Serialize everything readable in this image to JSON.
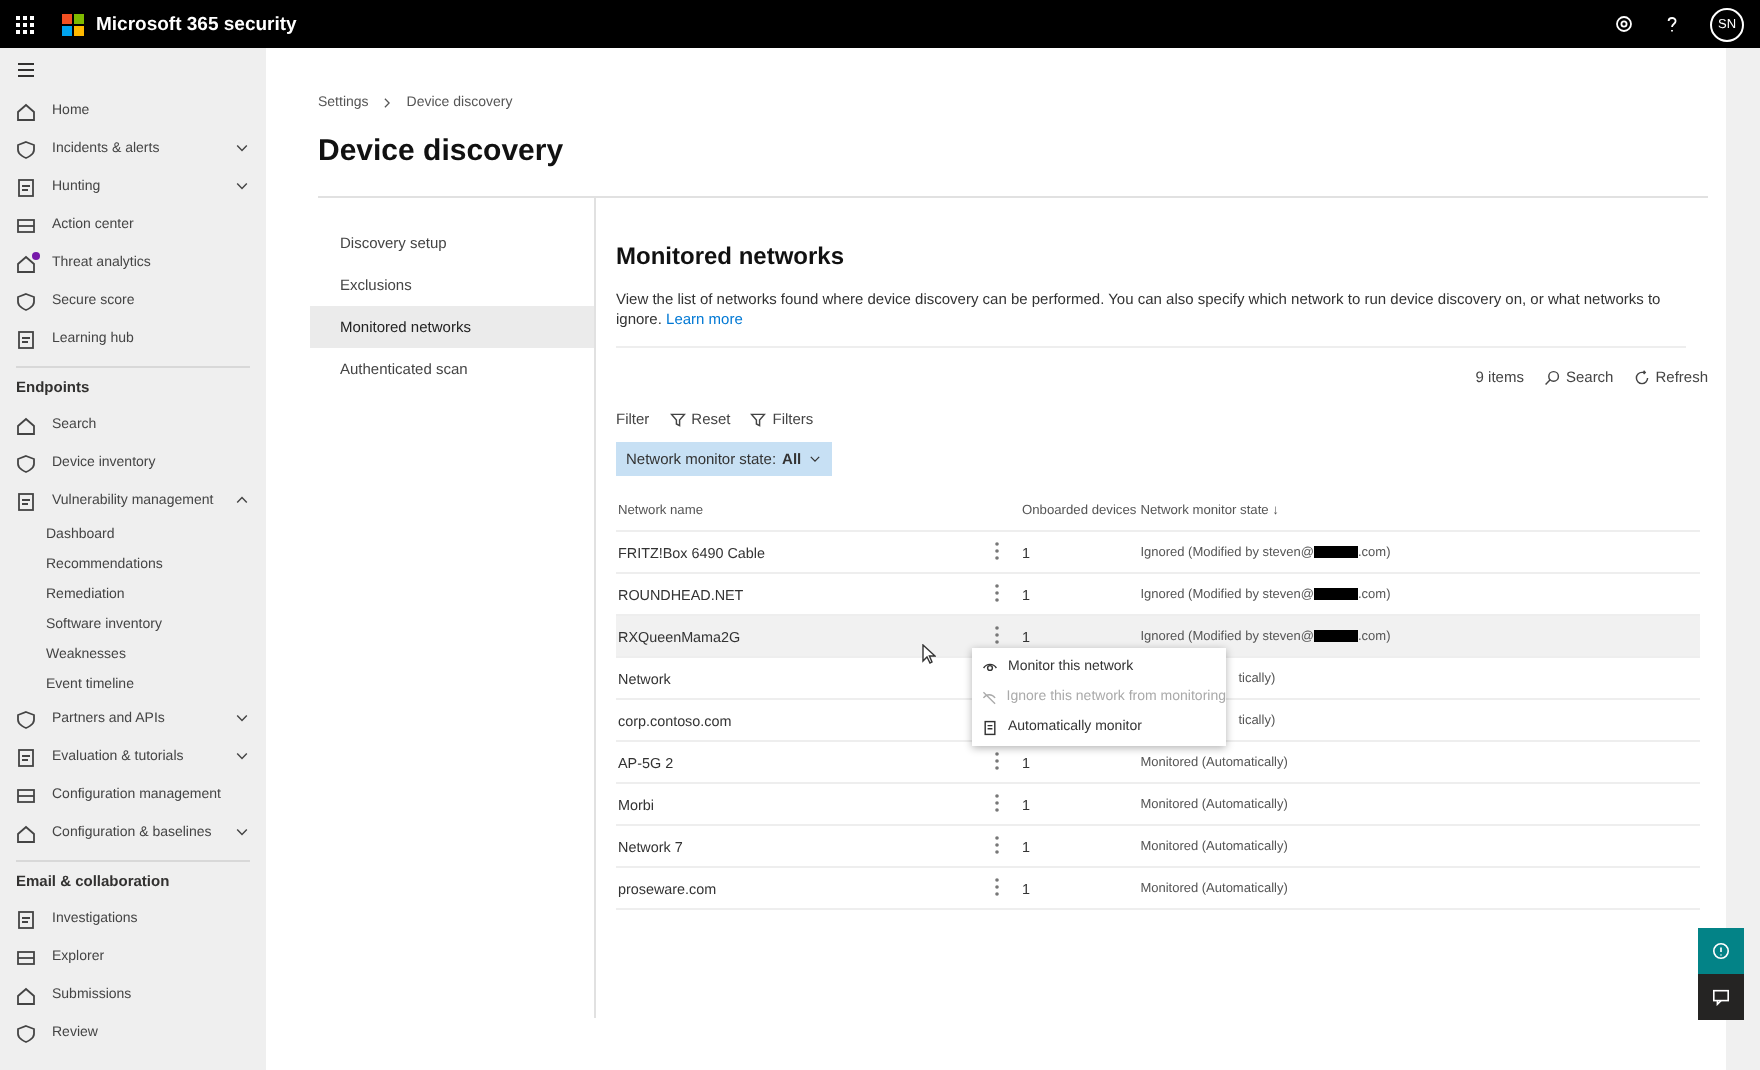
{
  "top_bar": {
    "app_name": "Microsoft 365 security",
    "avatar": "SN"
  },
  "sidebar": {
    "items": [
      {
        "kind": "item",
        "label": "Home"
      },
      {
        "kind": "item",
        "label": "Incidents & alerts",
        "expanded": false
      },
      {
        "kind": "item",
        "label": "Hunting",
        "expanded": false
      },
      {
        "kind": "item",
        "label": "Action center"
      },
      {
        "kind": "item",
        "label": "Threat analytics",
        "badge": true
      },
      {
        "kind": "item",
        "label": "Secure score"
      },
      {
        "kind": "item",
        "label": "Learning hub"
      },
      {
        "kind": "section",
        "label": "Endpoints"
      },
      {
        "kind": "item",
        "label": "Search"
      },
      {
        "kind": "item",
        "label": "Device inventory"
      },
      {
        "kind": "item",
        "label": "Vulnerability management",
        "expanded": true
      },
      {
        "kind": "sub",
        "label": "Dashboard"
      },
      {
        "kind": "sub",
        "label": "Recommendations"
      },
      {
        "kind": "sub",
        "label": "Remediation"
      },
      {
        "kind": "sub",
        "label": "Software inventory"
      },
      {
        "kind": "sub",
        "label": "Weaknesses"
      },
      {
        "kind": "sub",
        "label": "Event timeline"
      },
      {
        "kind": "item",
        "label": "Partners and APIs",
        "expanded": false
      },
      {
        "kind": "item",
        "label": "Evaluation & tutorials",
        "expanded": false
      },
      {
        "kind": "item",
        "label": "Configuration management"
      },
      {
        "kind": "item",
        "label": "Configuration & baselines",
        "expanded": false
      },
      {
        "kind": "section",
        "label": "Email & collaboration"
      },
      {
        "kind": "item",
        "label": "Investigations"
      },
      {
        "kind": "item",
        "label": "Explorer"
      },
      {
        "kind": "item",
        "label": "Submissions"
      },
      {
        "kind": "item",
        "label": "Review"
      }
    ]
  },
  "breadcrumb": [
    "Settings",
    "Device discovery"
  ],
  "page_title": "Device discovery",
  "settings_nav": [
    {
      "label": "Discovery setup",
      "selected": false
    },
    {
      "label": "Exclusions",
      "selected": false
    },
    {
      "label": "Monitored networks",
      "selected": true
    },
    {
      "label": "Authenticated scan",
      "selected": false
    }
  ],
  "section": {
    "title": "Monitored networks",
    "description": "View the list of networks found where device discovery can be performed. You can also specify which network to run device discovery on, or what networks to ignore.",
    "link": "Learn more"
  },
  "toolbar": {
    "count": "9 items",
    "search": "Search",
    "refresh": "Refresh"
  },
  "filter": {
    "label": "Filter",
    "reset": "Reset",
    "filters": "Filters",
    "chip_label": "Network monitor state:",
    "chip_value": "All"
  },
  "table": {
    "columns": [
      "Network name",
      "Onboarded devices",
      "Network monitor state ↓"
    ],
    "rows": [
      {
        "kind": "normal",
        "name": "FRITZ!Box 6490 Cable",
        "devices": "1",
        "state": "Ignored (Modified by steven@",
        "redacted": true,
        "state_end": ".com)",
        "selected": false
      },
      {
        "kind": "normal",
        "name": "ROUNDHEAD.NET",
        "devices": "1",
        "state": "Ignored (Modified by steven@",
        "redacted": true,
        "state_end": ".com)",
        "selected": false
      },
      {
        "kind": "normal",
        "name": "RXQueenMama2G",
        "devices": "1",
        "state": "Ignored (Modified by steven@",
        "redacted": true,
        "state_end": ".com)",
        "selected": true
      },
      {
        "kind": "covered",
        "name": "Network",
        "state": "tically)",
        "selected": false
      },
      {
        "kind": "covered",
        "name": "corp.contoso.com",
        "state": "tically)",
        "selected": false
      },
      {
        "kind": "normal",
        "name": "AP-5G 2",
        "devices": "1",
        "state": "Monitored (Automatically)",
        "selected": false
      },
      {
        "kind": "normal",
        "name": "Morbi",
        "devices": "1",
        "state": "Monitored (Automatically)",
        "selected": false
      },
      {
        "kind": "normal",
        "name": "Network 7",
        "devices": "1",
        "state": "Monitored (Automatically)",
        "selected": false
      },
      {
        "kind": "normal",
        "name": "proseware.com",
        "devices": "1",
        "state": "Monitored (Automatically)",
        "selected": false
      }
    ]
  },
  "context_menu": [
    {
      "label": "Monitor this network",
      "disabled": false
    },
    {
      "label": "Ignore this network from monitoring",
      "disabled": true
    },
    {
      "label": "Automatically monitor",
      "disabled": false
    }
  ]
}
